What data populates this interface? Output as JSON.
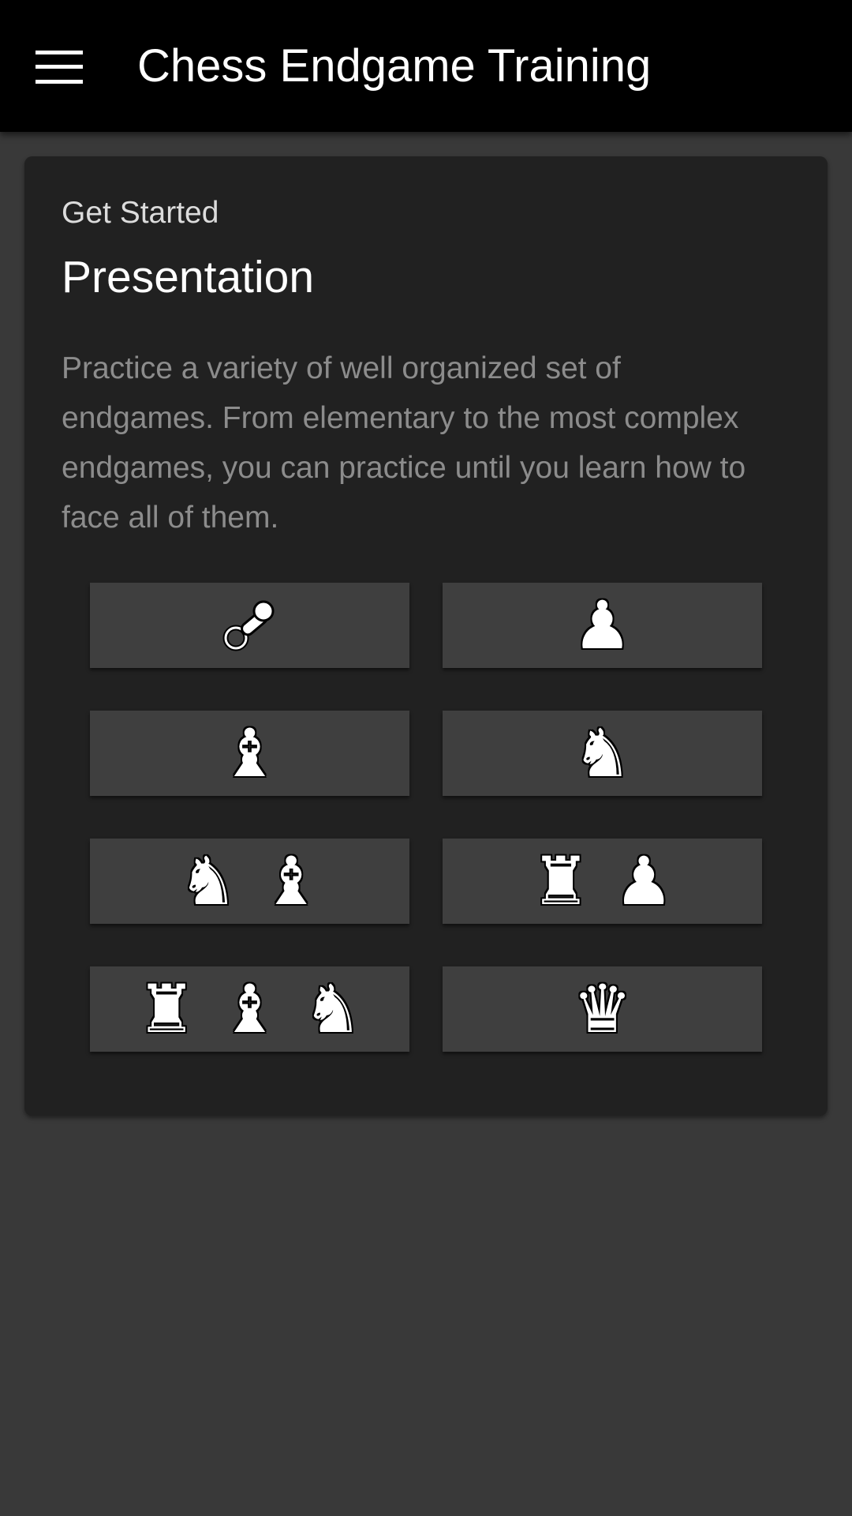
{
  "appbar": {
    "title": "Chess Endgame Training",
    "menu_icon": "hamburger-menu-icon"
  },
  "card": {
    "overline": "Get Started",
    "headline": "Presentation",
    "description": "Practice a variety of well organized set of endgames. From elementary to the most complex endgames, you can practice until you learn how to face all of them."
  },
  "categories": [
    {
      "icon": "pacifier-icon"
    },
    {
      "icon": "pawn-icon",
      "pieces": [
        "♟"
      ]
    },
    {
      "icon": "bishop-icon",
      "pieces": [
        "♝"
      ]
    },
    {
      "icon": "knight-icon",
      "pieces": [
        "♞"
      ]
    },
    {
      "icon": "knight-bishop-icon",
      "pieces": [
        "♞",
        "♝"
      ]
    },
    {
      "icon": "rook-pawn-icon",
      "pieces": [
        "♜",
        "♟"
      ]
    },
    {
      "icon": "rook-bishop-knight-icon",
      "pieces": [
        "♜",
        "♝",
        "♞"
      ]
    },
    {
      "icon": "queen-icon",
      "pieces": [
        "♛"
      ]
    }
  ],
  "colors": {
    "appbar": "#000000",
    "background": "#393939",
    "card": "#212121",
    "button": "#3f3f3f",
    "description_text": "#8c8c8c"
  }
}
